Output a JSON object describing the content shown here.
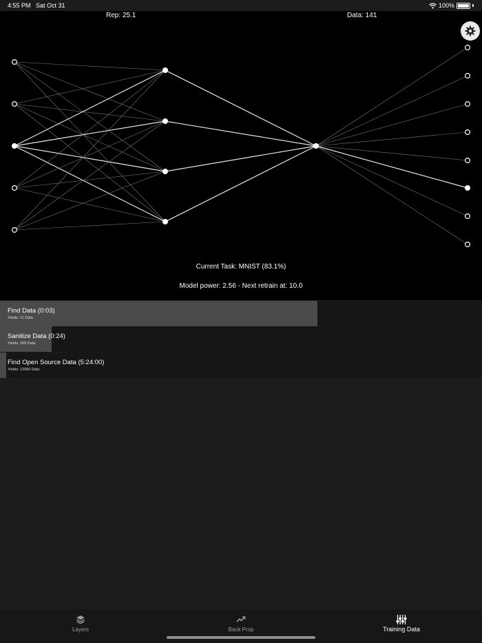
{
  "status_bar": {
    "time": "4:55 PM",
    "date": "Sat Oct 31",
    "battery": "100%",
    "icons": [
      "wifi-icon",
      "battery-icon"
    ]
  },
  "network": {
    "rep_label": "Rep: 25.1",
    "data_label": "Data: 141",
    "current_task": "Current Task: MNIST (83.1%)",
    "model_power": "Model power: 2.56 - Next retrain at: 10.0",
    "settings_icon": "gear-icon"
  },
  "tasks": [
    {
      "title": "Find Data (0:03)",
      "yield": "Yields: 11 Data",
      "progress": 0.659
    },
    {
      "title": "Sanitize Data (0:24)",
      "yield": "Yields: 189 Data",
      "progress": 0.107
    },
    {
      "title": "Find Open Source Data (5:24:00)",
      "yield": "Yields: 13996 Data",
      "progress": 0.013
    }
  ],
  "tabs": [
    {
      "label": "Layers",
      "icon": "layers-icon",
      "active": false
    },
    {
      "label": "Back Prop",
      "icon": "trend-up-icon",
      "active": false
    },
    {
      "label": "Training Data",
      "icon": "sliders-icon",
      "active": true
    }
  ],
  "colors": {
    "network_background": "#000000",
    "app_background": "#1c1c1c",
    "progress_fill": "#4a4a4a"
  }
}
